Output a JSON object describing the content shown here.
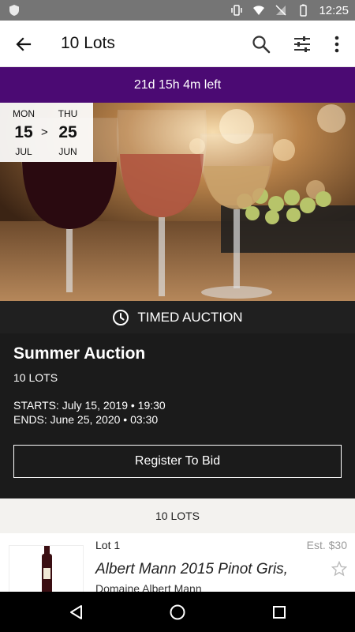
{
  "status_bar": {
    "time": "12:25"
  },
  "toolbar": {
    "title": "10 Lots",
    "icons": [
      "back-arrow-icon",
      "search-icon",
      "filter-sliders-icon",
      "more-vert-icon"
    ]
  },
  "countdown": {
    "text": "21d 15h 4m left",
    "color": "#4b0a73"
  },
  "date_range": {
    "start": {
      "dow": "MON",
      "day": "15",
      "month": "JUL"
    },
    "separator": ">",
    "end": {
      "dow": "THU",
      "day": "25",
      "month": "JUN"
    }
  },
  "auction": {
    "type_label": "TIMED AUCTION",
    "name": "Summer Auction",
    "lots_count": "10 LOTS",
    "starts": "STARTS: July 15, 2019 • 19:30",
    "ends": "ENDS: June 25, 2020 • 03:30",
    "register_label": "Register To Bid"
  },
  "lots_section": {
    "header": "10 LOTS",
    "items": [
      {
        "lot": "Lot 1",
        "estimate": "Est. $30",
        "title": "Albert Mann 2015 Pinot Gris,",
        "subtitle": "Domaine Albert Mann"
      }
    ]
  }
}
